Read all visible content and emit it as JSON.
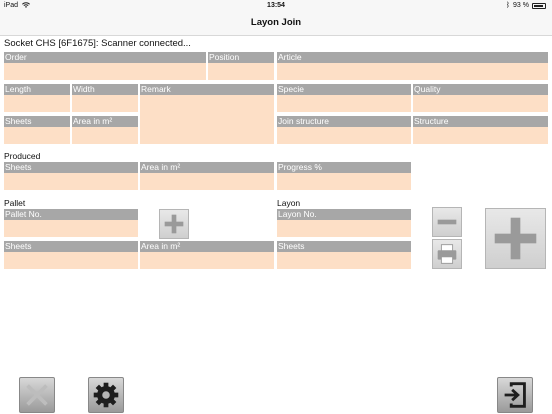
{
  "status": {
    "carrier": "iPad",
    "time": "13:54",
    "battery": "93 %"
  },
  "nav": {
    "title": "Layon Join"
  },
  "connection": {
    "text": "Socket CHS [6F1675]: Scanner connected..."
  },
  "labels": {
    "order": "Order",
    "position": "Position",
    "article": "Article",
    "length": "Length",
    "width": "Width",
    "remark": "Remark",
    "specie": "Specie",
    "quality": "Quality",
    "sheets": "Sheets",
    "area": "Area in m²",
    "join_structure": "Join structure",
    "structure": "Structure",
    "progress": "Progress %",
    "pallet_no": "Pallet No.",
    "layon_no": "Layon No."
  },
  "sections": {
    "produced": "Produced",
    "pallet": "Pallet",
    "layon": "Layon"
  },
  "fields": {
    "order": "",
    "position": "",
    "article": "",
    "length": "",
    "width": "",
    "remark": "",
    "specie": "",
    "quality": "",
    "sheets": "",
    "area": "",
    "join_structure": "",
    "structure": "",
    "produced_sheets": "",
    "produced_area": "",
    "progress": "",
    "pallet_no": "",
    "pallet_sheets": "",
    "pallet_area": "",
    "layon_no": "",
    "layon_sheets": ""
  },
  "icons": {
    "add_pallet": "plus-icon",
    "remove_layon": "minus-icon",
    "print": "printer-icon",
    "add_layon": "plus-icon",
    "cancel": "x-icon",
    "settings": "gear-icon",
    "exit": "exit-icon"
  }
}
